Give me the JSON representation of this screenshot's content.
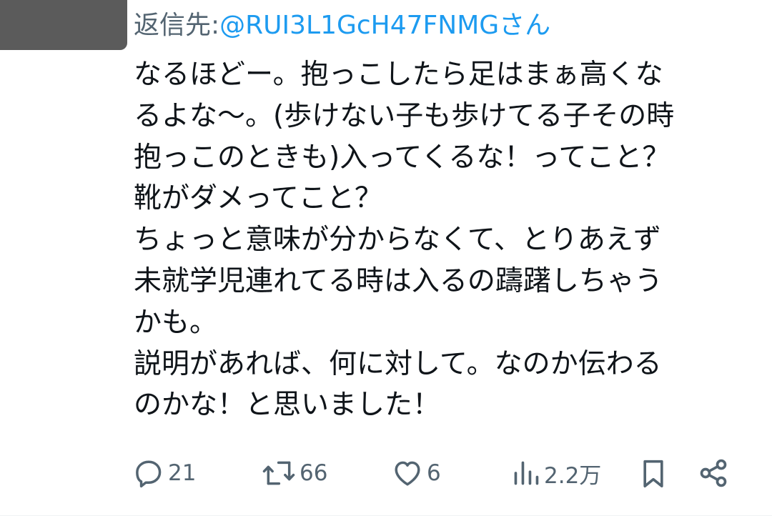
{
  "reply_to": {
    "prefix": "返信先: ",
    "handle": "@RUI3L1GcH47FNMG",
    "suffix": "さん"
  },
  "tweet": {
    "lines": [
      "なるほどー。抱っこしたら足はまぁ高くな",
      "るよな〜。(歩けない子も歩けてる子その時",
      "抱っこのときも)入ってくるな！ってこと？",
      "靴がダメってこと？",
      "ちょっと意味が分からなくて、とりあえず",
      "未就学児連れてる時は入るの躊躇しちゃう",
      "かも。",
      "説明があれば、何に対して。なのか伝わる",
      "のかな！と思いました！"
    ]
  },
  "actions": {
    "reply": {
      "icon": "reply-icon",
      "count": "21"
    },
    "retweet": {
      "icon": "retweet-icon",
      "count": "66"
    },
    "like": {
      "icon": "heart-icon",
      "count": "6"
    },
    "views": {
      "icon": "views-icon",
      "count": "2.2万"
    },
    "bookmark": {
      "icon": "bookmark-icon"
    },
    "share": {
      "icon": "share-icon"
    }
  },
  "colors": {
    "text": "#0f1419",
    "secondary": "#536471",
    "link": "#1d9bf0",
    "background": "#ffffff"
  }
}
